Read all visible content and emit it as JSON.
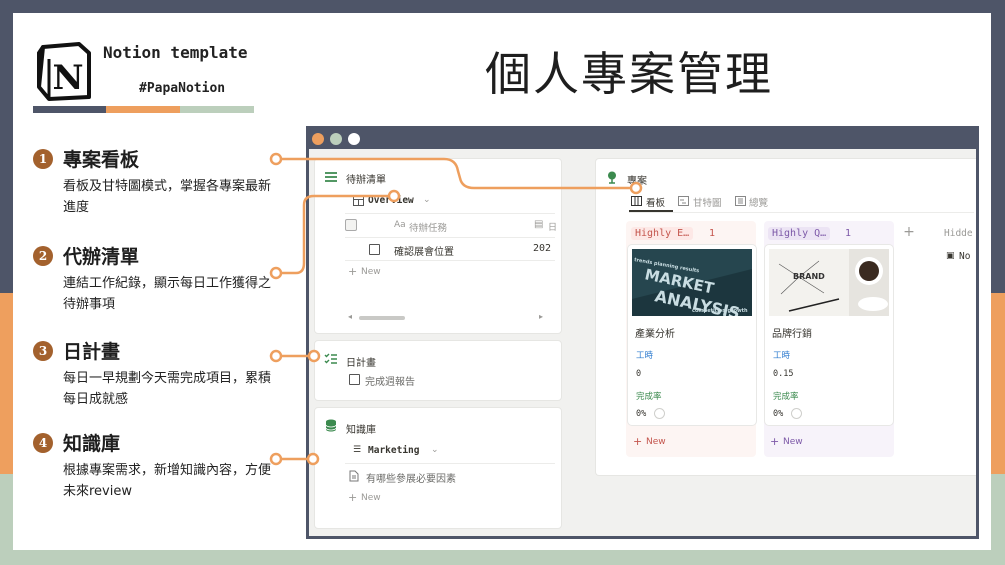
{
  "brand": {
    "logo_letter": "N",
    "line1": "Notion template",
    "line2": "#PapaNotion"
  },
  "page_title": "個人專案管理",
  "features": [
    {
      "number": "1",
      "title": "專案看板",
      "desc": "看板及甘特圖模式，掌握各專案最新進度"
    },
    {
      "number": "2",
      "title": "代辦清單",
      "desc": "連結工作紀錄，顯示每日工作獲得之待辦事項"
    },
    {
      "number": "3",
      "title": "日計畫",
      "desc": "每日一早規劃今天需完成項目，累積每日成就感"
    },
    {
      "number": "4",
      "title": "知識庫",
      "desc": "根據專案需求，新增知識內容，方便未來review"
    }
  ],
  "todo_panel": {
    "title": "待辦清單",
    "view_name": "Overview",
    "col_task": "待辦任務",
    "col_task_prefix": "Aa",
    "col_date_short": "日",
    "row_task": "確認展會位置",
    "row_date": "202",
    "new_label": "New"
  },
  "daily_panel": {
    "title": "日計畫",
    "item": "完成週報告"
  },
  "kb_panel": {
    "title": "知識庫",
    "view_name": "Marketing",
    "item": "有哪些參展必要因素",
    "new_label": "New"
  },
  "project_panel": {
    "title": "專案",
    "tabs": [
      "看板",
      "甘特圖",
      "總覽"
    ],
    "hidden_label": "Hidde",
    "hidden_item": "No",
    "columns": [
      {
        "group": "Highly E…",
        "count": "1",
        "card_title": "產業分析",
        "card_image_words": [
          "MARKET",
          "ANALYSIS"
        ],
        "prop1_label": "工時",
        "prop1_value": "0",
        "prop2_label": "完成率",
        "prop2_value": "0%",
        "new_label": "New",
        "group_color": "#c4554d",
        "group_bg": "#fde8e6"
      },
      {
        "group": "Highly Q…",
        "count": "1",
        "card_title": "品牌行銷",
        "card_image_words": [
          "BRAND"
        ],
        "prop1_label": "工時",
        "prop1_value": "0.15",
        "prop2_label": "完成率",
        "prop2_value": "0%",
        "new_label": "New",
        "group_color": "#7d59a8",
        "group_bg": "#ece4f4"
      }
    ]
  },
  "colors": {
    "navy": "#4e5568",
    "orange": "#ee9f5e",
    "sage": "#bccfbc",
    "number_badge": "#a3612d",
    "prop_blue": "#2e7bcf",
    "prop_green": "#3b8a4e"
  },
  "window_dots": [
    "#ee9f5e",
    "#bccfbc",
    "#ffffff"
  ]
}
